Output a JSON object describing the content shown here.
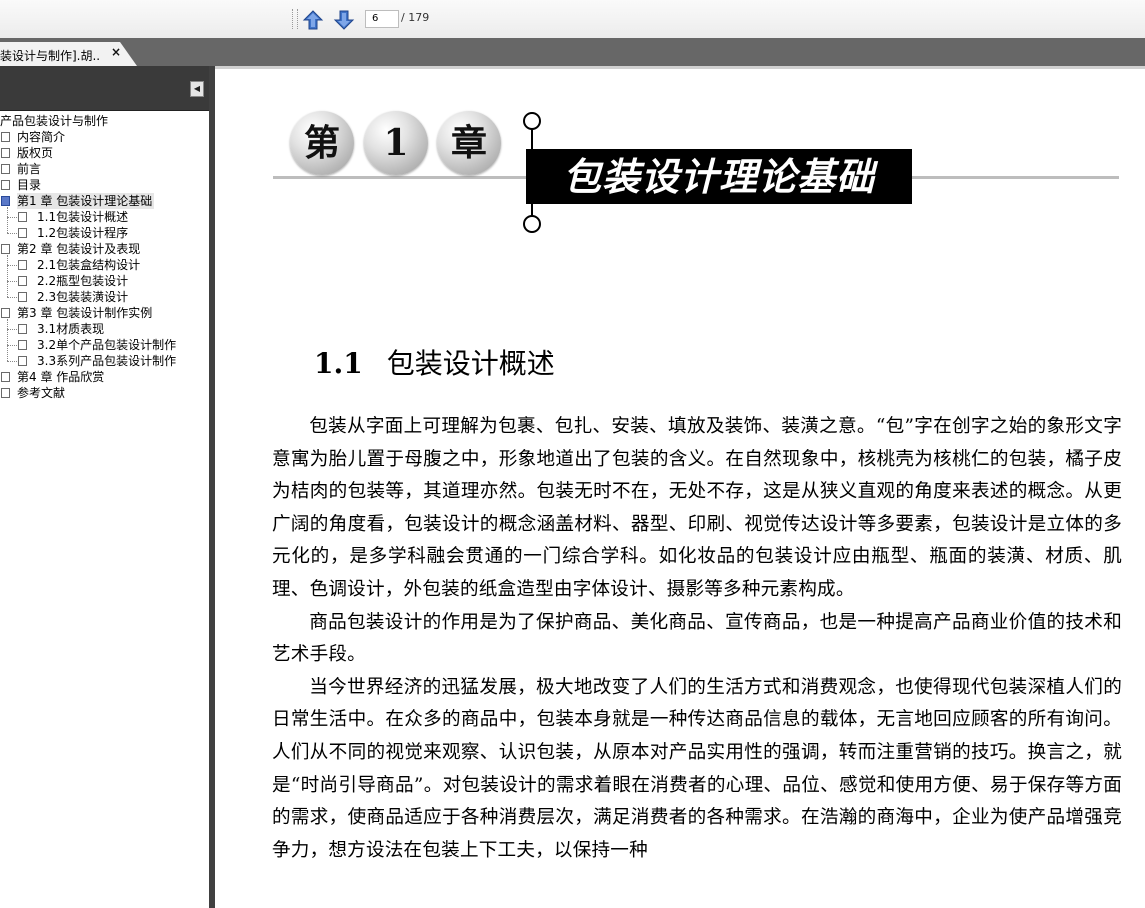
{
  "toolbar": {
    "current_page": "6",
    "total_pages": "/ 179",
    "prev_icon": "arrow-up-icon",
    "next_icon": "arrow-down-icon"
  },
  "tab": {
    "label": "装设计与制作].胡...",
    "close": "×"
  },
  "sidebar": {
    "items": [
      {
        "label": "产品包装设计与制作",
        "level": 0
      },
      {
        "label": "内容简介",
        "level": 1
      },
      {
        "label": "版权页",
        "level": 1
      },
      {
        "label": "前言",
        "level": 1
      },
      {
        "label": "目录",
        "level": 1
      },
      {
        "label": "第1 章  包装设计理论基础",
        "level": 1,
        "selected": true
      },
      {
        "label": "1.1包装设计概述",
        "level": 2
      },
      {
        "label": "1.2包装设计程序",
        "level": 2
      },
      {
        "label": "第2 章  包装设计及表现",
        "level": 1
      },
      {
        "label": "2.1包装盒结构设计",
        "level": 2
      },
      {
        "label": "2.2瓶型包装设计",
        "level": 2
      },
      {
        "label": "2.3包装装潢设计",
        "level": 2
      },
      {
        "label": "第3 章  包装设计制作实例",
        "level": 1
      },
      {
        "label": "3.1材质表现",
        "level": 2
      },
      {
        "label": "3.2单个产品包装设计制作",
        "level": 2
      },
      {
        "label": "3.3系列产品包装设计制作",
        "level": 2
      },
      {
        "label": "第4 章  作品欣赏",
        "level": 1
      },
      {
        "label": "参考文献",
        "level": 1
      }
    ]
  },
  "document": {
    "chapter_chars": [
      "第",
      "1",
      "章"
    ],
    "chapter_title": "包装设计理论基础",
    "section_number": "1.1",
    "section_title": "包装设计概述",
    "paragraphs": [
      "包装从字面上可理解为包裹、包扎、安装、填放及装饰、装潢之意。“包”字在创字之始的象形文字意寓为胎儿置于母腹之中，形象地道出了包装的含义。在自然现象中，核桃壳为核桃仁的包装，橘子皮为桔肉的包装等，其道理亦然。包装无时不在，无处不存，这是从狭义直观的角度来表述的概念。从更广阔的角度看，包装设计的概念涵盖材料、器型、印刷、视觉传达设计等多要素，包装设计是立体的多元化的，是多学科融会贯通的一门综合学科。如化妆品的包装设计应由瓶型、瓶面的装潢、材质、肌理、色调设计，外包装的纸盒造型由字体设计、摄影等多种元素构成。",
      "商品包装设计的作用是为了保护商品、美化商品、宣传商品，也是一种提高产品商业价值的技术和艺术手段。",
      "当今世界经济的迅猛发展，极大地改变了人们的生活方式和消费观念，也使得现代包装深植人们的日常生活中。在众多的商品中，包装本身就是一种传达商品信息的载体，无言地回应顾客的所有询问。人们从不同的视觉来观察、认识包装，从原本对产品实用性的强调，转而注重营销的技巧。换言之，就是“时尚引导商品”。对包装设计的需求着眼在消费者的心理、品位、感觉和使用方便、易于保存等方面的需求，使商品适应于各种消费层次，满足消费者的各种需求。在浩瀚的商海中，企业为使产品增强竞争力，想方设法在包装上下工夫，以保持一种"
    ]
  },
  "colors": {
    "tabbar": "#676767",
    "sidebar_header": "#3a3a3a",
    "arrow_blue": "#3f73c8",
    "title_block": "#000000"
  }
}
